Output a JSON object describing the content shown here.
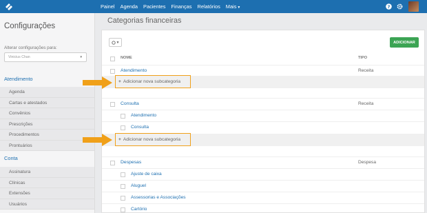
{
  "nav": {
    "items": [
      "Painel",
      "Agenda",
      "Pacientes",
      "Finanças",
      "Relatórios",
      "Mais"
    ]
  },
  "sidebar": {
    "title": "Configurações",
    "change_label": "Alterar configurações para:",
    "select_value": "Vinicius Chan",
    "sections": [
      {
        "label": "Atendimento",
        "items": [
          "Agenda",
          "Cartas e atestados",
          "Convênios",
          "Prescrições",
          "Procedimentos",
          "Prontuários"
        ]
      },
      {
        "label": "Conta",
        "items": [
          "Assinatura",
          "Clínicas",
          "Extensões",
          "Usuários"
        ]
      }
    ]
  },
  "main": {
    "title": "Categorias financeiras",
    "add_button": "ADICIONAR",
    "columns": {
      "name": "NOME",
      "type": "TIPO"
    },
    "add_sub_label": "Adicionar nova subcategoria",
    "categories": [
      {
        "name": "Atendimento",
        "type": "Receita",
        "subs": []
      },
      {
        "name": "Consulta",
        "type": "Receita",
        "subs": [
          "Atendimento",
          "Consulta"
        ]
      },
      {
        "name": "Despesas",
        "type": "Despesa",
        "subs": [
          "Ajuste de caixa",
          "Aluguel",
          "Assessorias e Associações",
          "Cartório"
        ]
      }
    ]
  },
  "colors": {
    "brand": "#1d6fb0",
    "add": "#3ca454",
    "highlight": "#f0a019"
  }
}
